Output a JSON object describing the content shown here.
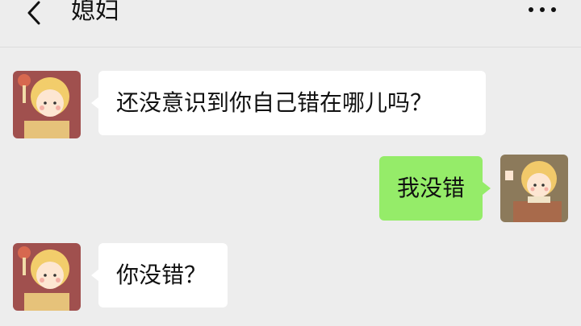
{
  "header": {
    "title": "媳妇",
    "back_icon": "chevron-left-icon",
    "more_icon": "more-dots-icon"
  },
  "messages": [
    {
      "side": "left",
      "text": "还没意识到你自己错在哪儿吗？",
      "avatar": "girl-avatar"
    },
    {
      "side": "right",
      "text": "我没错",
      "avatar": "boy-avatar"
    },
    {
      "side": "left",
      "text": "你没错？",
      "avatar": "girl-avatar"
    }
  ],
  "colors": {
    "background": "#ededed",
    "incoming_bubble": "#ffffff",
    "outgoing_bubble": "#95ec69"
  }
}
